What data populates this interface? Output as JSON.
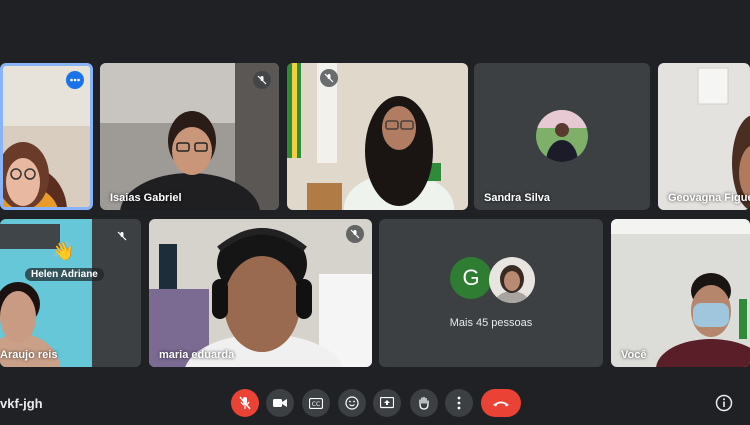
{
  "participants": [
    {
      "name": "Isaias Gabriel"
    },
    {
      "name": "Sandra Silva"
    },
    {
      "name": "Geovagna Figueiredo"
    },
    {
      "name": "Helen Adriane"
    },
    {
      "name": "Araujo reis"
    },
    {
      "name": "maria eduarda"
    },
    {
      "name": "Você"
    }
  ],
  "overflow": {
    "initial": "G",
    "label": "Mais 45 pessoas"
  },
  "meeting_code": "vkf-jgh",
  "controls": [
    "mic-off-icon",
    "camera-icon",
    "captions-icon",
    "emoji-icon",
    "present-icon",
    "raise-hand-icon",
    "more-options-icon",
    "hang-up-icon"
  ],
  "colors": {
    "background": "#202124",
    "tile": "#3c4043",
    "hangup": "#ea4335",
    "active_border": "#8ab4f8"
  }
}
